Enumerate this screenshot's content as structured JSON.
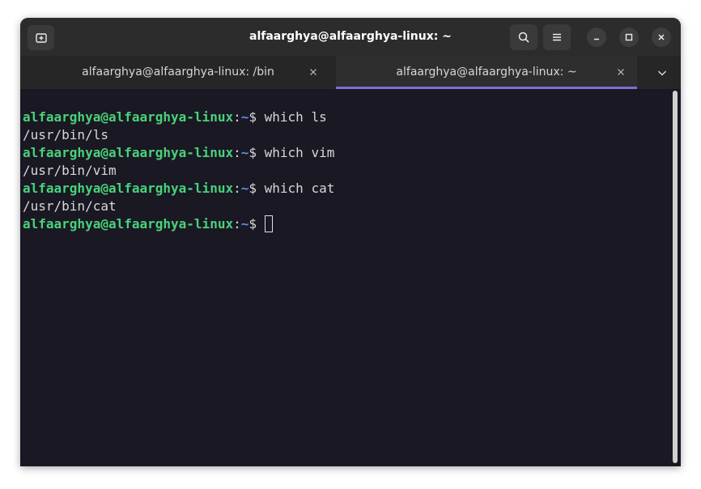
{
  "window": {
    "title": "alfaarghya@alfaarghya-linux: ~"
  },
  "header": {
    "new_tab_icon": "new-tab-icon",
    "search_icon": "search-icon",
    "menu_icon": "hamburger-menu-icon",
    "minimize_icon": "minimize-icon",
    "maximize_icon": "maximize-icon",
    "close_icon": "close-icon"
  },
  "tabs": [
    {
      "label": "alfaarghya@alfaarghya-linux: /bin",
      "active": false
    },
    {
      "label": "alfaarghya@alfaarghya-linux: ~",
      "active": true
    }
  ],
  "colors": {
    "background": "#191823",
    "prompt_user": "#49d17a",
    "prompt_path": "#5b8df0",
    "active_tab_accent": "#7b6fd6"
  },
  "terminal": {
    "lines": [
      {
        "type": "prompt",
        "user": "alfaarghya@alfaarghya-linux",
        "sep": ":",
        "path": "~",
        "symbol": "$ ",
        "command": "which ls"
      },
      {
        "type": "output",
        "text": "/usr/bin/ls"
      },
      {
        "type": "prompt",
        "user": "alfaarghya@alfaarghya-linux",
        "sep": ":",
        "path": "~",
        "symbol": "$ ",
        "command": "which vim"
      },
      {
        "type": "output",
        "text": "/usr/bin/vim"
      },
      {
        "type": "prompt",
        "user": "alfaarghya@alfaarghya-linux",
        "sep": ":",
        "path": "~",
        "symbol": "$ ",
        "command": "which cat"
      },
      {
        "type": "output",
        "text": "/usr/bin/cat"
      },
      {
        "type": "prompt",
        "user": "alfaarghya@alfaarghya-linux",
        "sep": ":",
        "path": "~",
        "symbol": "$ ",
        "command": ""
      }
    ]
  }
}
